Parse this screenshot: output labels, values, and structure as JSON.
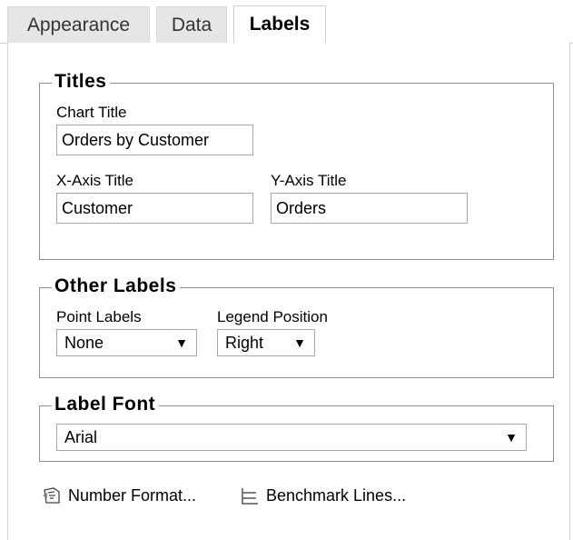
{
  "tabs": [
    {
      "label": "Appearance",
      "active": false
    },
    {
      "label": "Data",
      "active": false
    },
    {
      "label": "Labels",
      "active": true
    }
  ],
  "titles_group": {
    "legend": "Titles",
    "chart_title_label": "Chart Title",
    "chart_title_value": "Orders by Customer",
    "x_axis_title_label": "X-Axis Title",
    "x_axis_title_value": "Customer",
    "y_axis_title_label": "Y-Axis Title",
    "y_axis_title_value": "Orders"
  },
  "other_labels_group": {
    "legend": "Other Labels",
    "point_labels_label": "Point Labels",
    "point_labels_value": "None",
    "legend_position_label": "Legend Position",
    "legend_position_value": "Right"
  },
  "label_font_group": {
    "legend": "Label Font",
    "font_value": "Arial"
  },
  "actions": {
    "number_format": "Number Format...",
    "benchmark_lines": "Benchmark Lines..."
  },
  "icons": {
    "number_format": "number-format-icon",
    "benchmark_lines": "benchmark-lines-icon",
    "dropdown": "triangle-down-icon"
  }
}
